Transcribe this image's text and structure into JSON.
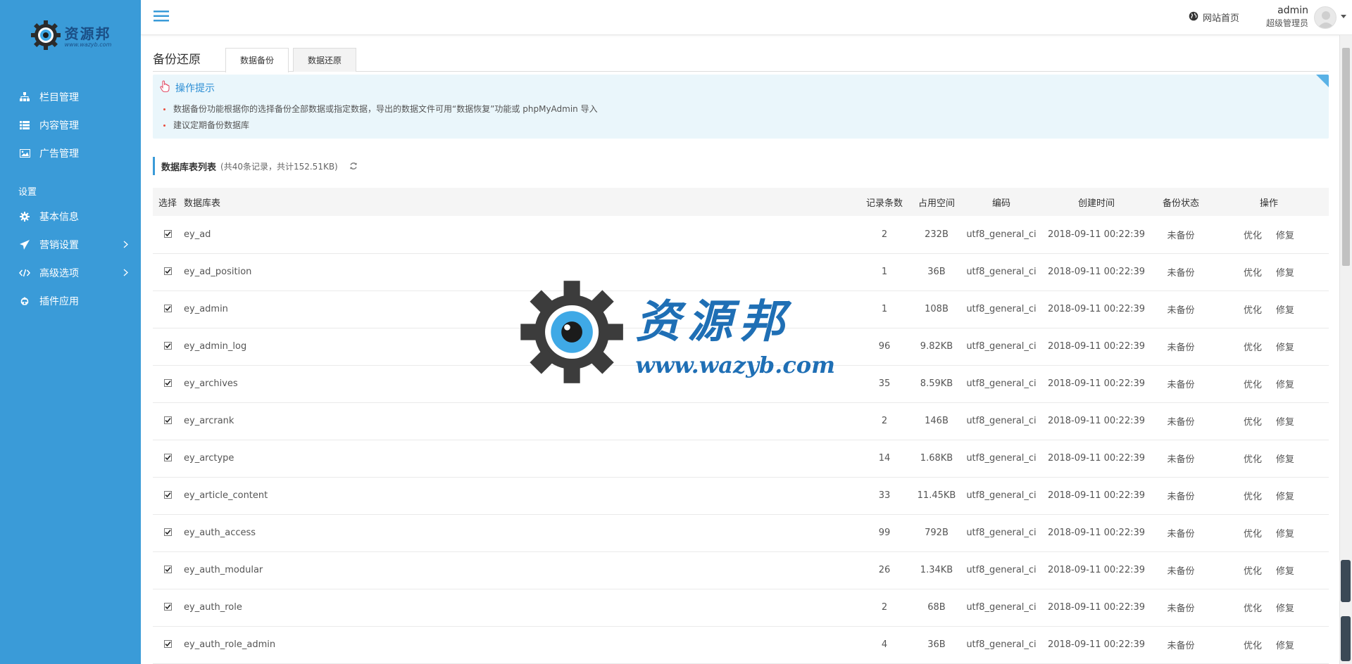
{
  "logo": {
    "cn": "资源邦",
    "en": "www.wazyb.com"
  },
  "sidebar": {
    "items": [
      {
        "label": "栏目管理",
        "icon": "sitemap-icon"
      },
      {
        "label": "内容管理",
        "icon": "list-icon"
      },
      {
        "label": "广告管理",
        "icon": "image-icon"
      }
    ],
    "section_label": "设置",
    "settings_items": [
      {
        "label": "基本信息",
        "icon": "gear-icon",
        "has_chevron": false
      },
      {
        "label": "营销设置",
        "icon": "paper-plane-icon",
        "has_chevron": true
      },
      {
        "label": "高级选项",
        "icon": "code-icon",
        "has_chevron": true
      },
      {
        "label": "插件应用",
        "icon": "recycle-icon",
        "has_chevron": false
      }
    ]
  },
  "topbar": {
    "home_label": "网站首页",
    "user_name": "admin",
    "user_role": "超级管理员"
  },
  "page": {
    "title": "备份还原",
    "tabs": [
      {
        "label": "数据备份",
        "active": true
      },
      {
        "label": "数据还原",
        "active": false
      }
    ]
  },
  "tips": {
    "title": "操作提示",
    "items": [
      "数据备份功能根据你的选择备份全部数据或指定数据，导出的数据文件可用“数据恢复”功能或 phpMyAdmin 导入",
      "建议定期备份数据库"
    ]
  },
  "list": {
    "title": "数据库表列表",
    "summary": "(共40条记录，共计152.51KB)"
  },
  "table": {
    "headers": {
      "select": "选择",
      "name": "数据库表",
      "records": "记录条数",
      "size": "占用空间",
      "encoding": "编码",
      "created": "创建时间",
      "status": "备份状态",
      "ops": "操作"
    },
    "op_optimize": "优化",
    "op_repair": "修复",
    "rows": [
      {
        "name": "ey_ad",
        "records": "2",
        "size": "232B",
        "encoding": "utf8_general_ci",
        "created": "2018-09-11 00:22:39",
        "status": "未备份"
      },
      {
        "name": "ey_ad_position",
        "records": "1",
        "size": "36B",
        "encoding": "utf8_general_ci",
        "created": "2018-09-11 00:22:39",
        "status": "未备份"
      },
      {
        "name": "ey_admin",
        "records": "1",
        "size": "108B",
        "encoding": "utf8_general_ci",
        "created": "2018-09-11 00:22:39",
        "status": "未备份"
      },
      {
        "name": "ey_admin_log",
        "records": "96",
        "size": "9.82KB",
        "encoding": "utf8_general_ci",
        "created": "2018-09-11 00:22:39",
        "status": "未备份"
      },
      {
        "name": "ey_archives",
        "records": "35",
        "size": "8.59KB",
        "encoding": "utf8_general_ci",
        "created": "2018-09-11 00:22:39",
        "status": "未备份"
      },
      {
        "name": "ey_arcrank",
        "records": "2",
        "size": "146B",
        "encoding": "utf8_general_ci",
        "created": "2018-09-11 00:22:39",
        "status": "未备份"
      },
      {
        "name": "ey_arctype",
        "records": "14",
        "size": "1.68KB",
        "encoding": "utf8_general_ci",
        "created": "2018-09-11 00:22:39",
        "status": "未备份"
      },
      {
        "name": "ey_article_content",
        "records": "33",
        "size": "11.45KB",
        "encoding": "utf8_general_ci",
        "created": "2018-09-11 00:22:39",
        "status": "未备份"
      },
      {
        "name": "ey_auth_access",
        "records": "99",
        "size": "792B",
        "encoding": "utf8_general_ci",
        "created": "2018-09-11 00:22:39",
        "status": "未备份"
      },
      {
        "name": "ey_auth_modular",
        "records": "26",
        "size": "1.34KB",
        "encoding": "utf8_general_ci",
        "created": "2018-09-11 00:22:39",
        "status": "未备份"
      },
      {
        "name": "ey_auth_role",
        "records": "2",
        "size": "68B",
        "encoding": "utf8_general_ci",
        "created": "2018-09-11 00:22:39",
        "status": "未备份"
      },
      {
        "name": "ey_auth_role_admin",
        "records": "4",
        "size": "36B",
        "encoding": "utf8_general_ci",
        "created": "2018-09-11 00:22:39",
        "status": "未备份"
      }
    ]
  },
  "watermark": {
    "cn": "资源邦",
    "en": "www.wazyb.com"
  },
  "colors": {
    "sidebar": "#3a9bd8",
    "accent": "#2c8ed4",
    "tips_bg": "#eaf6fb"
  }
}
